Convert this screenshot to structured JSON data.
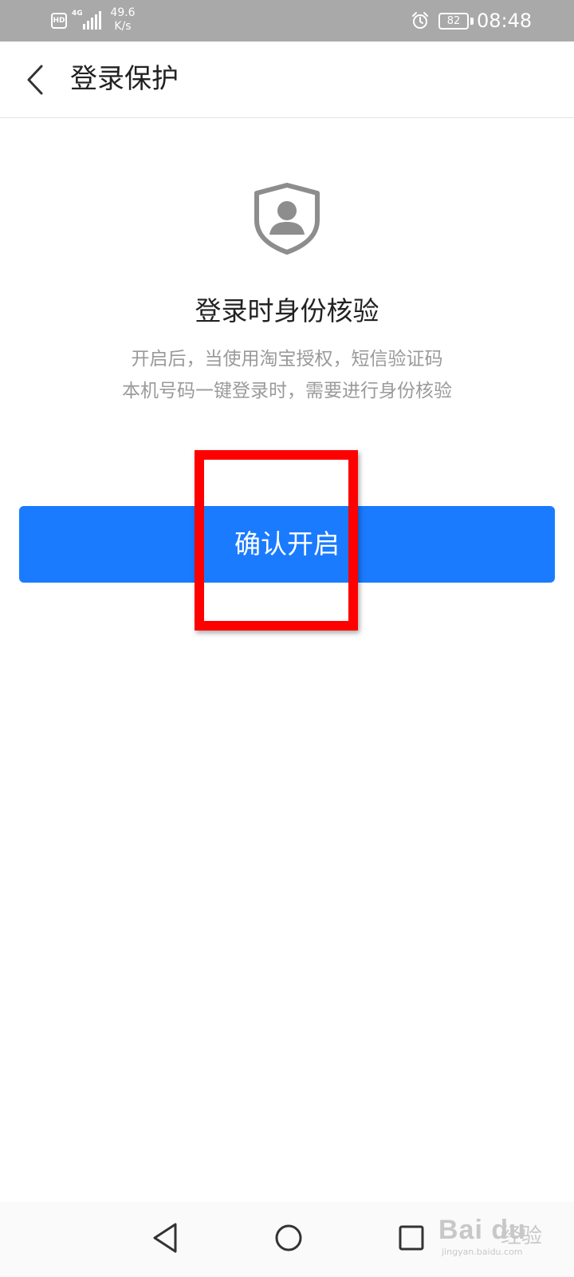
{
  "status_bar": {
    "hd_label": "HD",
    "network_type": "4G",
    "network_speed_value": "49.6",
    "network_speed_unit": "K/s",
    "battery_level": "82",
    "time": "08:48"
  },
  "header": {
    "title": "登录保护"
  },
  "content": {
    "icon": "shield-user-icon",
    "feature_title": "登录时身份核验",
    "description_line_1": "开启后，当使用淘宝授权，短信验证码",
    "description_line_2": "本机号码一键登录时，需要进行身份核验",
    "confirm_label": "确认开启"
  },
  "watermark": {
    "logo": "Bai du",
    "suffix": "经验",
    "url": "jingyan.baidu.com"
  },
  "colors": {
    "status_bar_bg": "#a9a9a9",
    "accent_button": "#1a7bff",
    "annotation": "#ff0000",
    "description_text": "#9a9a9a"
  }
}
